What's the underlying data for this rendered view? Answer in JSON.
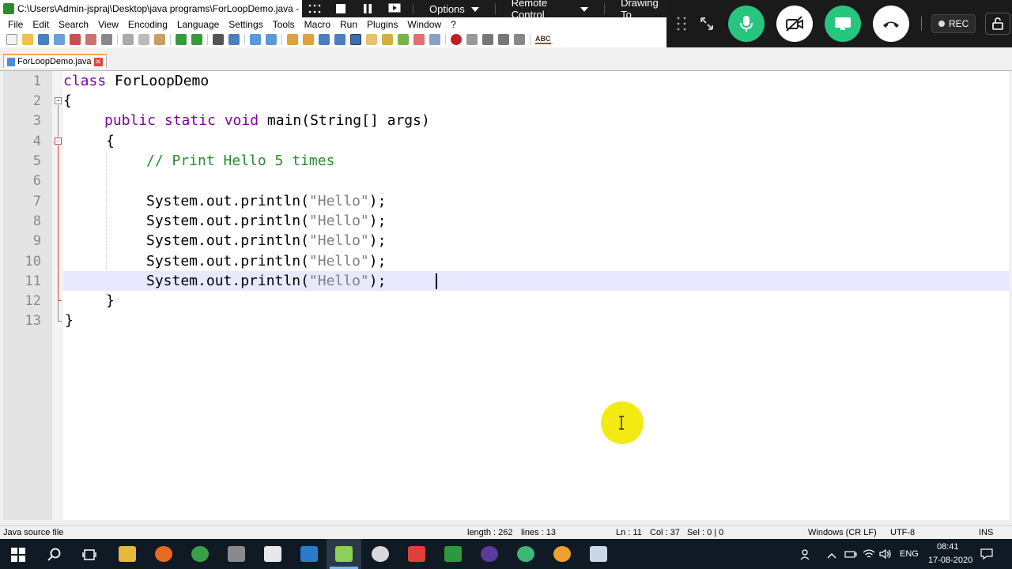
{
  "window": {
    "title": "C:\\Users\\Admin-jspraj\\Desktop\\java programs\\ForLoopDemo.java - Not"
  },
  "remote_bar": {
    "options_label": "Options",
    "remote_control_label": "Remote Control",
    "drawing_label": "Drawing To"
  },
  "meeting": {
    "rec_label": "REC",
    "colors": {
      "green": "#27c57e",
      "bar": "#1a1a1a"
    }
  },
  "menu": {
    "items": [
      "File",
      "Edit",
      "Search",
      "View",
      "Encoding",
      "Language",
      "Settings",
      "Tools",
      "Macro",
      "Run",
      "Plugins",
      "Window",
      "?"
    ]
  },
  "toolbar": {
    "spellcheck_label": "ABC"
  },
  "tab": {
    "label": "ForLoopDemo.java"
  },
  "editor": {
    "line_numbers": [
      "1",
      "2",
      "3",
      "4",
      "5",
      "6",
      "7",
      "8",
      "9",
      "10",
      "11",
      "12",
      "13"
    ],
    "lines": [
      {
        "kw": "class",
        "rest": " ForLoopDemo"
      },
      {
        "text": "{"
      },
      {
        "kw": "public static void",
        "rest": " main(String[] args)"
      },
      {
        "text": "{"
      },
      {
        "comment": "// Print Hello 5 times"
      },
      {
        "text": ""
      },
      {
        "pre": "System.out.println(",
        "str": "\"Hello\"",
        "post": ");"
      },
      {
        "pre": "System.out.println(",
        "str": "\"Hello\"",
        "post": ");"
      },
      {
        "pre": "System.out.println(",
        "str": "\"Hello\"",
        "post": ");"
      },
      {
        "pre": "System.out.println(",
        "str": "\"Hello\"",
        "post": ");"
      },
      {
        "pre": "System.out.println(",
        "str": "\"Hello\"",
        "post": ");"
      },
      {
        "text": "}"
      },
      {
        "text": "}"
      }
    ],
    "current_line": 11,
    "colors": {
      "keyword": "#8000a0",
      "comment": "#2e8b2e",
      "string": "#808080",
      "current_line_bg": "#e8e8ff"
    }
  },
  "status": {
    "file_type": "Java source file",
    "length": "length : 262",
    "lines": "lines : 13",
    "ln": "Ln : 11",
    "col": "Col : 37",
    "sel": "Sel : 0 | 0",
    "eol": "Windows (CR LF)",
    "encoding": "UTF-8",
    "mode": "INS"
  },
  "taskbar": {
    "language": "ENG",
    "time": "08:41",
    "date": "17-08-2020"
  }
}
